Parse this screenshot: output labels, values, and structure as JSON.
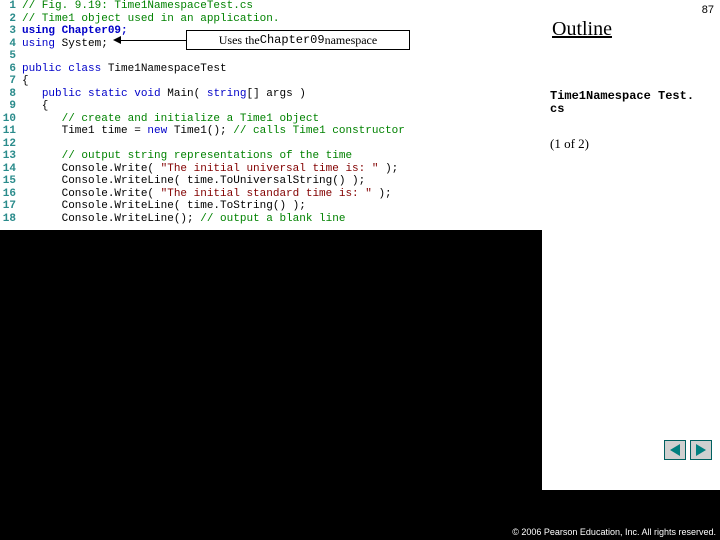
{
  "page_number": "87",
  "outline_label": "Outline",
  "filename_line1": "Time1Namespace Test.",
  "filename_line2": "cs",
  "part_label": "(1 of 2)",
  "callout_pre": "Uses the ",
  "callout_mono": "Chapter09",
  "callout_post": " namespace",
  "copyright": "© 2006 Pearson Education, Inc.  All rights reserved.",
  "code": [
    {
      "n": "1",
      "spans": [
        {
          "cls": "c-comment",
          "t": "// Fig. 9.19: Time1NamespaceTest.cs"
        }
      ]
    },
    {
      "n": "2",
      "spans": [
        {
          "cls": "c-comment",
          "t": "// Time1 object used in an application."
        }
      ]
    },
    {
      "n": "3",
      "spans": [
        {
          "cls": "c-keybold",
          "t": "using Chapter09;"
        }
      ]
    },
    {
      "n": "4",
      "spans": [
        {
          "cls": "c-key",
          "t": "using"
        },
        {
          "cls": "c-plain",
          "t": " System;"
        }
      ]
    },
    {
      "n": "5",
      "spans": [
        {
          "cls": "c-plain",
          "t": ""
        }
      ]
    },
    {
      "n": "6",
      "spans": [
        {
          "cls": "c-key",
          "t": "public class"
        },
        {
          "cls": "c-plain",
          "t": " Time1NamespaceTest"
        }
      ]
    },
    {
      "n": "7",
      "spans": [
        {
          "cls": "c-plain",
          "t": "{"
        }
      ]
    },
    {
      "n": "8",
      "spans": [
        {
          "cls": "c-plain",
          "t": "   "
        },
        {
          "cls": "c-key",
          "t": "public static void"
        },
        {
          "cls": "c-plain",
          "t": " Main( "
        },
        {
          "cls": "c-key",
          "t": "string"
        },
        {
          "cls": "c-plain",
          "t": "[] args )"
        }
      ]
    },
    {
      "n": "9",
      "spans": [
        {
          "cls": "c-plain",
          "t": "   {"
        }
      ]
    },
    {
      "n": "10",
      "spans": [
        {
          "cls": "c-plain",
          "t": "      "
        },
        {
          "cls": "c-comment",
          "t": "// create and initialize a Time1 object"
        }
      ]
    },
    {
      "n": "11",
      "spans": [
        {
          "cls": "c-plain",
          "t": "      Time1 time = "
        },
        {
          "cls": "c-key",
          "t": "new"
        },
        {
          "cls": "c-plain",
          "t": " Time1(); "
        },
        {
          "cls": "c-comment",
          "t": "// calls Time1 constructor"
        }
      ]
    },
    {
      "n": "12",
      "spans": [
        {
          "cls": "c-plain",
          "t": ""
        }
      ]
    },
    {
      "n": "13",
      "spans": [
        {
          "cls": "c-plain",
          "t": "      "
        },
        {
          "cls": "c-comment",
          "t": "// output string representations of the time"
        }
      ]
    },
    {
      "n": "14",
      "spans": [
        {
          "cls": "c-plain",
          "t": "      Console.Write( "
        },
        {
          "cls": "c-str",
          "t": "\"The initial universal time is: \""
        },
        {
          "cls": "c-plain",
          "t": " );"
        }
      ]
    },
    {
      "n": "15",
      "spans": [
        {
          "cls": "c-plain",
          "t": "      Console.WriteLine( time.ToUniversalString() );"
        }
      ]
    },
    {
      "n": "16",
      "spans": [
        {
          "cls": "c-plain",
          "t": "      Console.Write( "
        },
        {
          "cls": "c-str",
          "t": "\"The initial standard time is: \""
        },
        {
          "cls": "c-plain",
          "t": " );"
        }
      ]
    },
    {
      "n": "17",
      "spans": [
        {
          "cls": "c-plain",
          "t": "      Console.WriteLine( time.ToString() );"
        }
      ]
    },
    {
      "n": "18",
      "spans": [
        {
          "cls": "c-plain",
          "t": "      Console.WriteLine(); "
        },
        {
          "cls": "c-comment",
          "t": "// output a blank line"
        }
      ]
    }
  ]
}
